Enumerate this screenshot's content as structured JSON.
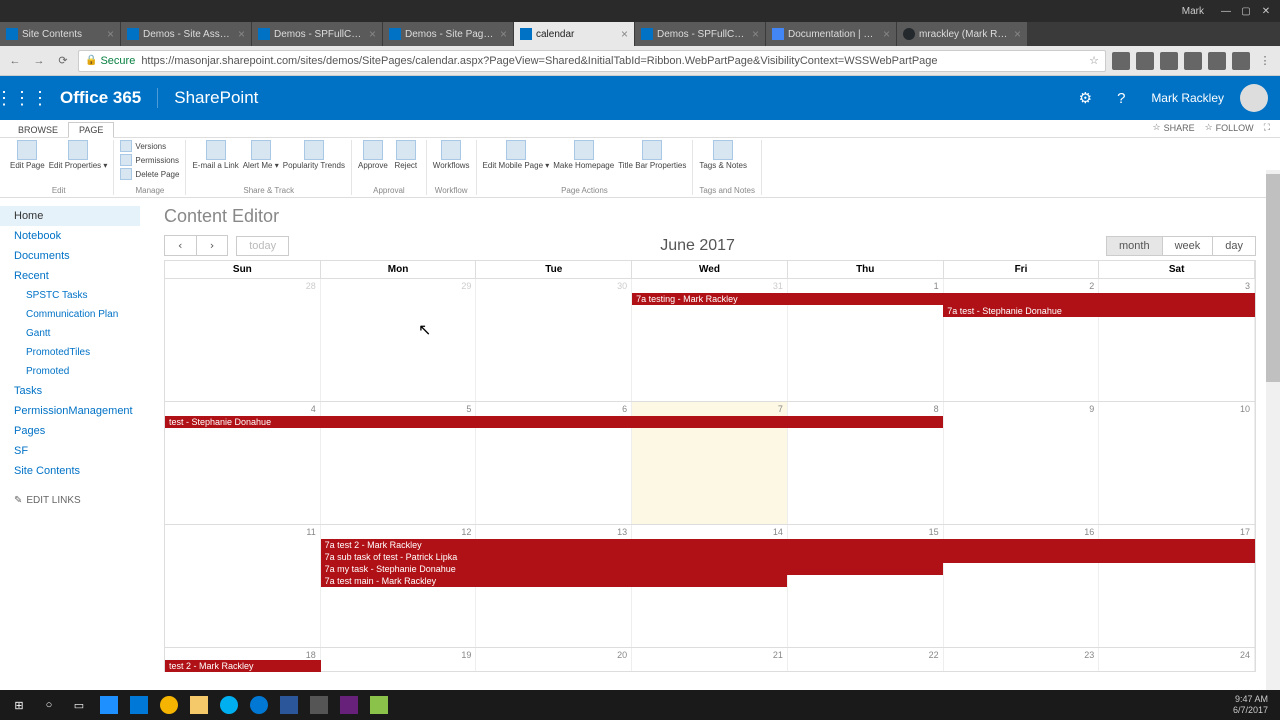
{
  "titlebar": {
    "user": "Mark",
    "min": "—",
    "max": "▢",
    "close": "✕"
  },
  "tabs": [
    {
      "label": "Site Contents",
      "cls": ""
    },
    {
      "label": "Demos - Site Assets - Al",
      "cls": ""
    },
    {
      "label": "Demos - SPFullCalenda",
      "cls": ""
    },
    {
      "label": "Demos - Site Pages - Al",
      "cls": ""
    },
    {
      "label": "calendar",
      "cls": "active"
    },
    {
      "label": "Demos - SPFullCalenda",
      "cls": ""
    },
    {
      "label": "Documentation | FullC",
      "cls": "fc"
    },
    {
      "label": "mrackley (Mark Rackle",
      "cls": "gh"
    }
  ],
  "addr": {
    "secure": "Secure",
    "url": "https://masonjar.sharepoint.com/sites/demos/SitePages/calendar.aspx?PageView=Shared&InitialTabId=Ribbon.WebPartPage&VisibilityContext=WSSWebPartPage"
  },
  "suite": {
    "o365": "Office 365",
    "app": "SharePoint",
    "user": "Mark Rackley"
  },
  "ribbon": {
    "tabs": {
      "browse": "BROWSE",
      "page": "PAGE"
    },
    "share": "SHARE",
    "follow": "FOLLOW",
    "groups": {
      "edit": {
        "label": "Edit",
        "editpage": "Edit Page",
        "props": "Edit Properties ▾"
      },
      "manage": {
        "label": "Manage",
        "versions": "Versions",
        "perms": "Permissions",
        "del": "Delete Page"
      },
      "share_track": {
        "label": "Share & Track",
        "email": "E-mail a Link",
        "alert": "Alert Me ▾",
        "pop": "Popularity Trends"
      },
      "approval": {
        "label": "Approval",
        "approve": "Approve",
        "reject": "Reject"
      },
      "workflow": {
        "label": "Workflow",
        "wf": "Workflows"
      },
      "page_actions": {
        "label": "Page Actions",
        "mobile": "Edit Mobile Page ▾",
        "home": "Make Homepage",
        "titlebar": "Title Bar Properties"
      },
      "tags": {
        "label": "Tags and Notes",
        "tags": "Tags & Notes"
      }
    }
  },
  "nav": {
    "home": "Home",
    "notebook": "Notebook",
    "documents": "Documents",
    "recent": "Recent",
    "spstc": "SPSTC Tasks",
    "comm": "Communication Plan",
    "gantt": "Gantt",
    "ptiles": "PromotedTiles",
    "promoted": "Promoted",
    "tasks": "Tasks",
    "perm": "PermissionManagement",
    "pages": "Pages",
    "sf": "SF",
    "sitecontents": "Site Contents",
    "editlinks": "EDIT LINKS"
  },
  "content_editor": "Content Editor",
  "cal": {
    "prev": "‹",
    "next": "›",
    "today": "today",
    "title": "June 2017",
    "month": "month",
    "week": "week",
    "day": "day",
    "days": [
      "Sun",
      "Mon",
      "Tue",
      "Wed",
      "Thu",
      "Fri",
      "Sat"
    ],
    "grid": [
      [
        "28",
        "29",
        "30",
        "31",
        "1",
        "2",
        "3"
      ],
      [
        "4",
        "5",
        "6",
        "7",
        "8",
        "9",
        "10"
      ],
      [
        "11",
        "12",
        "13",
        "14",
        "15",
        "16",
        "17"
      ],
      [
        "18",
        "19",
        "20",
        "21",
        "22",
        "23",
        "24"
      ]
    ],
    "events": {
      "r0a": "7a testing - Mark Rackley",
      "r0b": "7a test - Stephanie Donahue",
      "r1a": "test - Stephanie Donahue",
      "r2a": "7a test 2 - Mark Rackley",
      "r2b": "7a sub task of test - Patrick Lipka",
      "r2c": "7a my task - Stephanie Donahue",
      "r2d": "7a test main - Mark Rackley",
      "r3a": "test 2 - Mark Rackley"
    }
  },
  "clock": {
    "time": "9:47 AM",
    "date": "6/7/2017"
  }
}
